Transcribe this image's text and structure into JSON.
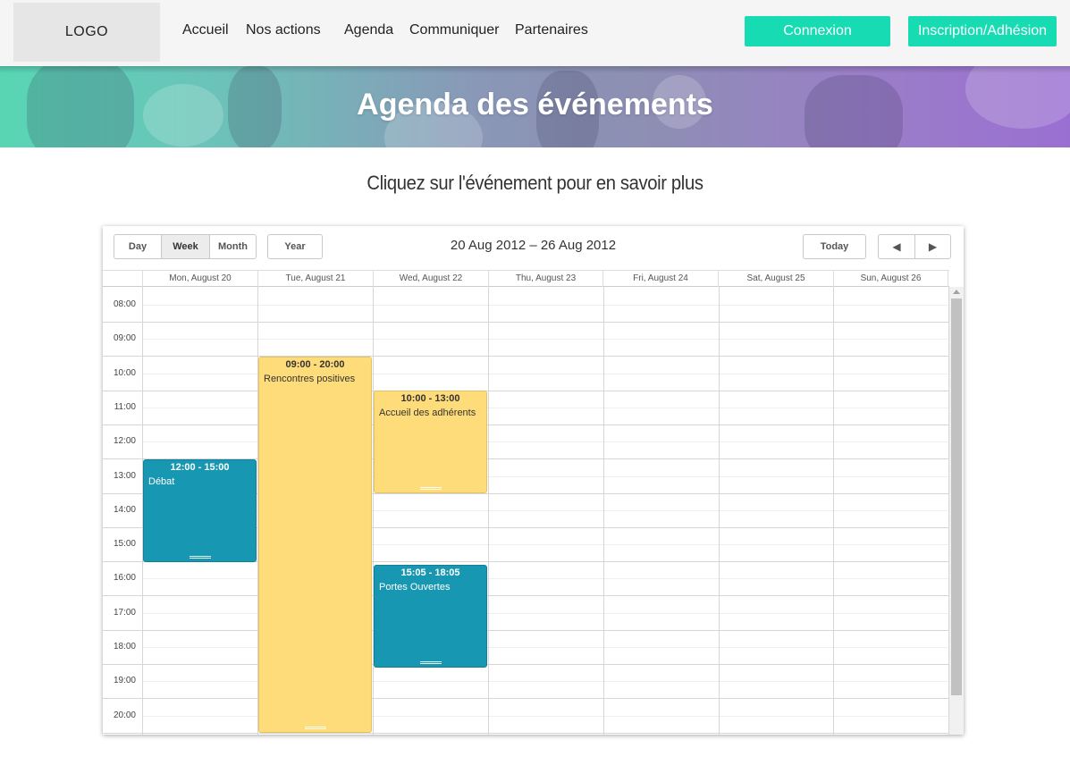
{
  "header": {
    "logo": "LOGO",
    "nav": [
      "Accueil",
      "Nos actions",
      "Agenda",
      "Communiquer",
      "Partenaires"
    ],
    "login": "Connexion",
    "signup": "Inscription/Adhésion",
    "accent_color": "#16dbb3"
  },
  "banner": {
    "title": "Agenda des événements"
  },
  "intro": "Cliquez sur l'événement pour en savoir plus",
  "calendar": {
    "view_buttons": [
      "Day",
      "Week",
      "Month"
    ],
    "active_view": "Week",
    "year_button": "Year",
    "range": "20 Aug 2012 – 26 Aug 2012",
    "today_button": "Today",
    "prev_icon": "◀",
    "next_icon": "▶",
    "days": [
      "Mon, August 20",
      "Tue, August 21",
      "Wed, August 22",
      "Thu, August 23",
      "Fri, August 24",
      "Sat, August 25",
      "Sun, August 26"
    ],
    "hours": [
      "08:00",
      "09:00",
      "10:00",
      "11:00",
      "12:00",
      "13:00",
      "14:00",
      "15:00",
      "16:00",
      "17:00",
      "18:00",
      "19:00",
      "20:00"
    ],
    "events": [
      {
        "day": 1,
        "start": 9,
        "end": 20,
        "time": "09:00 - 20:00",
        "title": "Rencontres positives",
        "color": "yellow"
      },
      {
        "day": 2,
        "start": 10,
        "end": 13,
        "time": "10:00 - 13:00",
        "title": "Accueil des adhérents",
        "color": "yellow"
      },
      {
        "day": 0,
        "start": 12,
        "end": 15,
        "time": "12:00 - 15:00",
        "title": "Débat",
        "color": "blue"
      },
      {
        "day": 2,
        "start": 15.083,
        "end": 18.083,
        "time": "15:05 - 18:05",
        "title": "Portes Ouvertes",
        "color": "blue"
      }
    ]
  }
}
